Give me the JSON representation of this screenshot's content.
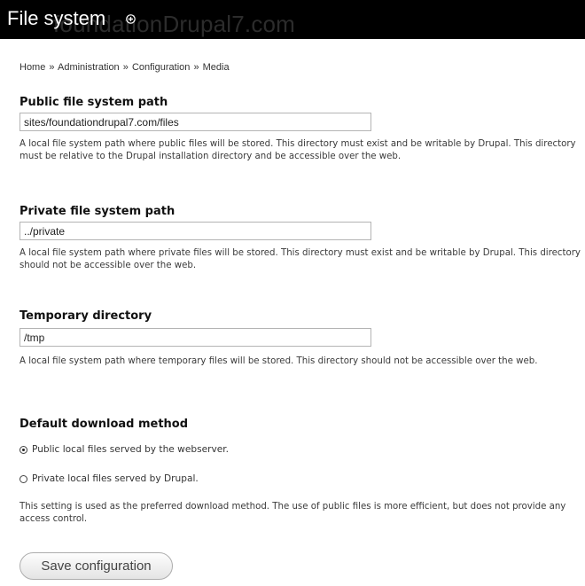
{
  "header": {
    "title": "File system",
    "watermark": "foundationDrupal7.com",
    "icon": "plus-circle-icon"
  },
  "breadcrumb": {
    "items": [
      "Home",
      "Administration",
      "Configuration",
      "Media"
    ],
    "separator": "»"
  },
  "fields": {
    "public": {
      "label": "Public file system path",
      "value": "sites/foundationdrupal7.com/files",
      "description": "A local file system path where public files will be stored. This directory must exist and be writable by Drupal. This directory must be relative to the Drupal installation directory and be accessible over the web."
    },
    "private": {
      "label": "Private file system path",
      "value": "../private",
      "description": "A local file system path where private files will be stored. This directory must exist and be writable by Drupal. This directory should not be accessible over the web."
    },
    "temporary": {
      "label": "Temporary directory",
      "value": "/tmp",
      "description": "A local file system path where temporary files will be stored. This directory should not be accessible over the web."
    }
  },
  "download_method": {
    "label": "Default download method",
    "options": [
      {
        "label": "Public local files served by the webserver.",
        "checked": true
      },
      {
        "label": "Private local files served by Drupal.",
        "checked": false
      }
    ],
    "description": "This setting is used as the preferred download method. The use of public files is more efficient, but does not provide any access control."
  },
  "actions": {
    "save_label": "Save configuration"
  }
}
